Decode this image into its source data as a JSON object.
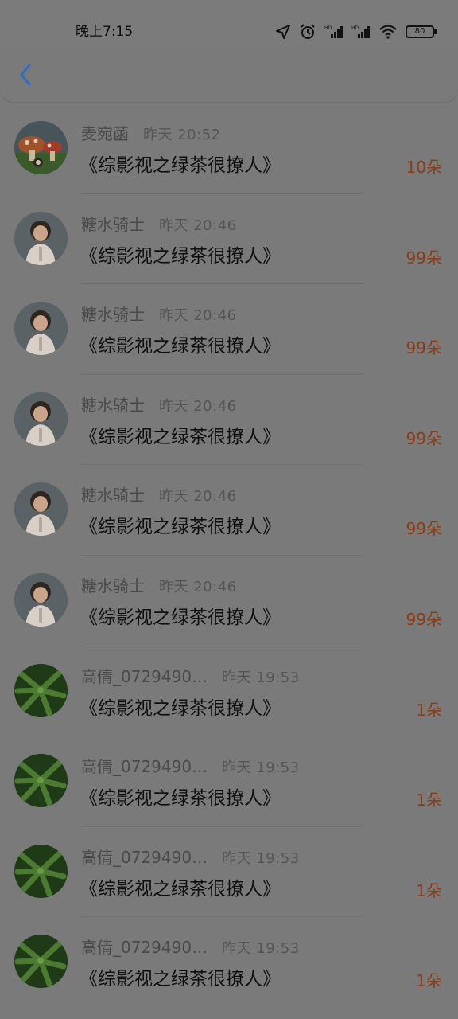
{
  "status_bar": {
    "time": "晚上7:15",
    "battery": "80"
  },
  "list": [
    {
      "name": "麦宛菡",
      "time": "昨天 20:52",
      "title": "《综影视之绿茶很撩人》",
      "amount": "10朵",
      "avatar": "mushroom-avatar"
    },
    {
      "name": "糖水骑士",
      "time": "昨天 20:46",
      "title": "《综影视之绿茶很撩人》",
      "amount": "99朵",
      "avatar": "child-avatar"
    },
    {
      "name": "糖水骑士",
      "time": "昨天 20:46",
      "title": "《综影视之绿茶很撩人》",
      "amount": "99朵",
      "avatar": "child-avatar"
    },
    {
      "name": "糖水骑士",
      "time": "昨天 20:46",
      "title": "《综影视之绿茶很撩人》",
      "amount": "99朵",
      "avatar": "child-avatar"
    },
    {
      "name": "糖水骑士",
      "time": "昨天 20:46",
      "title": "《综影视之绿茶很撩人》",
      "amount": "99朵",
      "avatar": "child-avatar"
    },
    {
      "name": "糖水骑士",
      "time": "昨天 20:46",
      "title": "《综影视之绿茶很撩人》",
      "amount": "99朵",
      "avatar": "child-avatar"
    },
    {
      "name": "高倩_0729490…",
      "time": "昨天 19:53",
      "title": "《综影视之绿茶很撩人》",
      "amount": "1朵",
      "avatar": "leaf-avatar"
    },
    {
      "name": "高倩_0729490…",
      "time": "昨天 19:53",
      "title": "《综影视之绿茶很撩人》",
      "amount": "1朵",
      "avatar": "leaf-avatar"
    },
    {
      "name": "高倩_0729490…",
      "time": "昨天 19:53",
      "title": "《综影视之绿茶很撩人》",
      "amount": "1朵",
      "avatar": "leaf-avatar"
    },
    {
      "name": "高倩_0729490…",
      "time": "昨天 19:53",
      "title": "《综影视之绿茶很撩人》",
      "amount": "1朵",
      "avatar": "leaf-avatar"
    }
  ],
  "colors": {
    "accent_back": "#2f6fbf",
    "amount": "#8a3b14"
  }
}
